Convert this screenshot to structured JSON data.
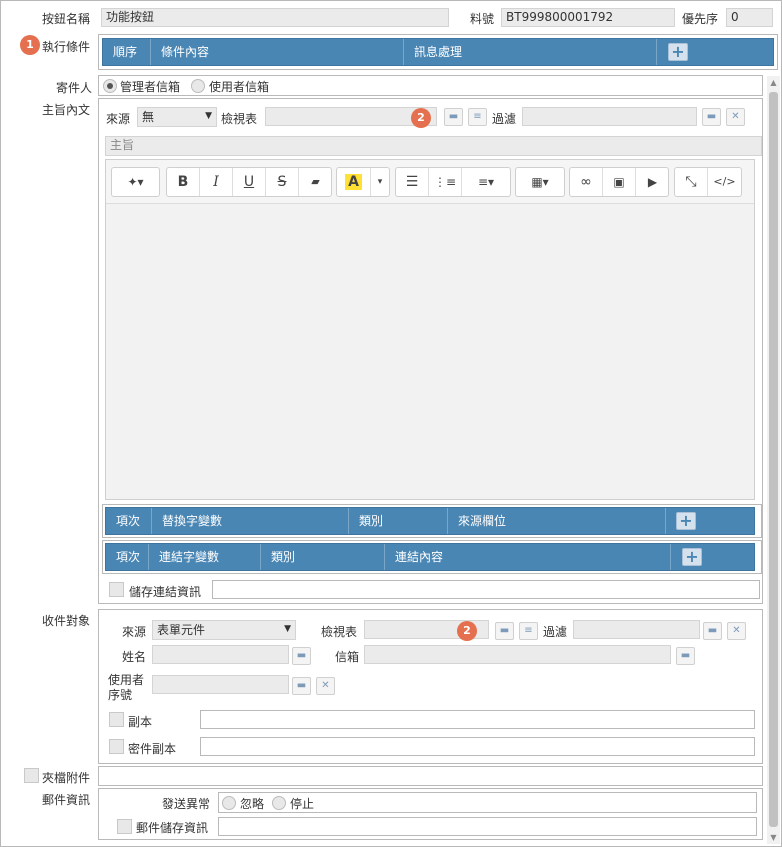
{
  "top": {
    "button_name_label": "按鈕名稱",
    "button_name_value": "功能按鈕",
    "item_no_label": "料號",
    "item_no_value": "BT999800001792",
    "priority_label": "優先序",
    "priority_value": "0"
  },
  "exec": {
    "badge": "1",
    "label": "執行條件",
    "columns": [
      "順序",
      "條件內容",
      "訊息處理"
    ]
  },
  "sender": {
    "label": "寄件人",
    "options": [
      "管理者信箱",
      "使用者信箱"
    ],
    "selected": "管理者信箱"
  },
  "body": {
    "label": "主旨內文",
    "source_label": "來源",
    "source_value": "無",
    "view_label": "檢視表",
    "badge": "2",
    "filter_label": "過濾",
    "subject_placeholder": "主旨",
    "replace_columns": [
      "項次",
      "替換字變數",
      "類別",
      "來源欄位"
    ],
    "link_columns": [
      "項次",
      "連結字變數",
      "類別",
      "連結內容"
    ],
    "save_link_label": "儲存連結資訊"
  },
  "editor_toolbar": {
    "magic_icon": "magic-wand-icon",
    "bold": "B",
    "italic": "I",
    "underline": "U",
    "strike": "S",
    "highlight": "A"
  },
  "recipient": {
    "label": "收件對象",
    "source_label": "來源",
    "source_value": "表單元件",
    "view_label": "檢視表",
    "badge": "2",
    "filter_label": "過濾",
    "name_label": "姓名",
    "mailbox_label": "信箱",
    "user_id_label_1": "使用者",
    "user_id_label_2": "序號",
    "cc_label": "副本",
    "bcc_label": "密件副本"
  },
  "attachment": {
    "label": "夾檔附件"
  },
  "mail_info": {
    "label": "郵件資訊",
    "error_label": "發送異常",
    "options": [
      "忽略",
      "停止"
    ],
    "save_mail_label": "郵件儲存資訊"
  },
  "colors": {
    "header_blue": "#4a86b4",
    "badge_orange": "#e4704f"
  }
}
